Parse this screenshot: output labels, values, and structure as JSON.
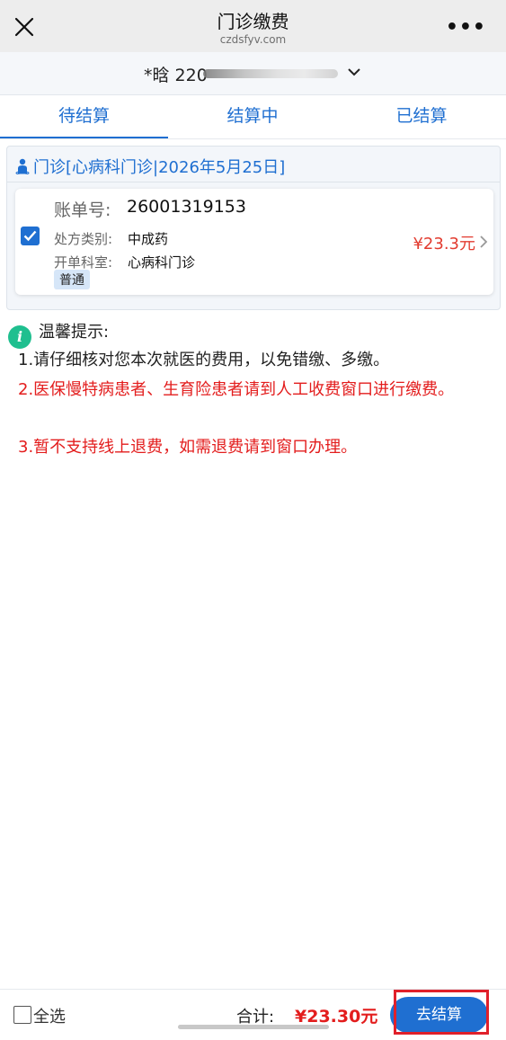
{
  "nav": {
    "title": "门诊缴费",
    "subtitle": "czdsfyv.com",
    "more": "•••"
  },
  "patient": {
    "name_prefix": "*晗 220"
  },
  "tabs": [
    {
      "label": "待结算",
      "active": true
    },
    {
      "label": "结算中",
      "active": false
    },
    {
      "label": "已结算",
      "active": false
    }
  ],
  "visit": {
    "title": "门诊[心病科门诊|2026年5月25日]",
    "bill": {
      "bill_no_label": "账单号:",
      "bill_no": "26001319153",
      "rx_type_label": "处方类别:",
      "rx_type": "中成药",
      "dept_label": "开单科室:",
      "dept": "心病科门诊",
      "badge": "普通",
      "amount": "¥23.3元",
      "checked": true
    }
  },
  "tips": {
    "heading": "温馨提示:",
    "line1": "1.请仔细核对您本次就医的费用，以免错缴、多缴。",
    "line2": "2.医保慢特病患者、生育险患者请到人工收费窗口进行缴费。",
    "line3": "3.暂不支持线上退费，如需退费请到窗口办理。"
  },
  "footer": {
    "select_all": "全选",
    "total_label": "合计:",
    "total_amount": "¥23.30元",
    "checkout": "去结算"
  },
  "colors": {
    "accent": "#1f6fd1",
    "danger": "#e31d1d",
    "info": "#1fbf8f"
  }
}
